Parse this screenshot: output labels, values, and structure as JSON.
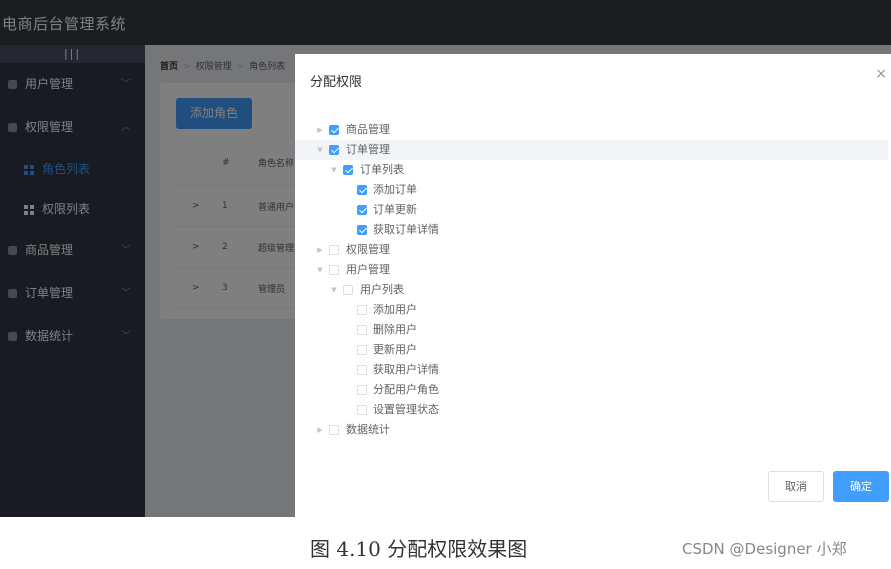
{
  "header": {
    "title": "电商后台管理系统"
  },
  "sidebar": {
    "toggle": "|||",
    "menus": [
      {
        "label": "用户管理",
        "arrow": "﹀"
      },
      {
        "label": "权限管理",
        "arrow": "︿"
      },
      {
        "label": "商品管理",
        "arrow": "﹀"
      },
      {
        "label": "订单管理",
        "arrow": "﹀"
      },
      {
        "label": "数据统计",
        "arrow": "﹀"
      }
    ],
    "submenus": [
      {
        "label": "角色列表"
      },
      {
        "label": "权限列表"
      }
    ]
  },
  "breadcrumb": [
    "首页",
    "权限管理",
    "角色列表"
  ],
  "card": {
    "add_button": "添加角色",
    "table": {
      "headers": [
        "#",
        "角色名称"
      ],
      "rows": [
        {
          "expand": ">",
          "index": "1",
          "name": "普通用户"
        },
        {
          "expand": ">",
          "index": "2",
          "name": "超级管理"
        },
        {
          "expand": ">",
          "index": "3",
          "name": "管理员"
        }
      ]
    }
  },
  "dialog": {
    "title": "分配权限",
    "close": "×",
    "tree": [
      {
        "label": "商品管理",
        "checked": true
      },
      {
        "label": "订单管理",
        "checked": true
      },
      {
        "label": "订单列表",
        "checked": true
      },
      {
        "label": "添加订单",
        "checked": true
      },
      {
        "label": "订单更新",
        "checked": true
      },
      {
        "label": "获取订单详情",
        "checked": true
      },
      {
        "label": "权限管理",
        "checked": false
      },
      {
        "label": "用户管理",
        "checked": false
      },
      {
        "label": "用户列表",
        "checked": false
      },
      {
        "label": "添加用户",
        "checked": false
      },
      {
        "label": "删除用户",
        "checked": false
      },
      {
        "label": "更新用户",
        "checked": false
      },
      {
        "label": "获取用户详情",
        "checked": false
      },
      {
        "label": "分配用户角色",
        "checked": false
      },
      {
        "label": "设置管理状态",
        "checked": false
      },
      {
        "label": "数据统计",
        "checked": false
      }
    ],
    "cancel": "取消",
    "confirm": "确定"
  },
  "caption": "图 4.10  分配权限效果图",
  "watermark": "CSDN @Designer 小郑",
  "colors": {
    "primary": "#409eff",
    "header": "#373d41",
    "sidebar": "#333744",
    "main_bg": "#eaedf1"
  }
}
